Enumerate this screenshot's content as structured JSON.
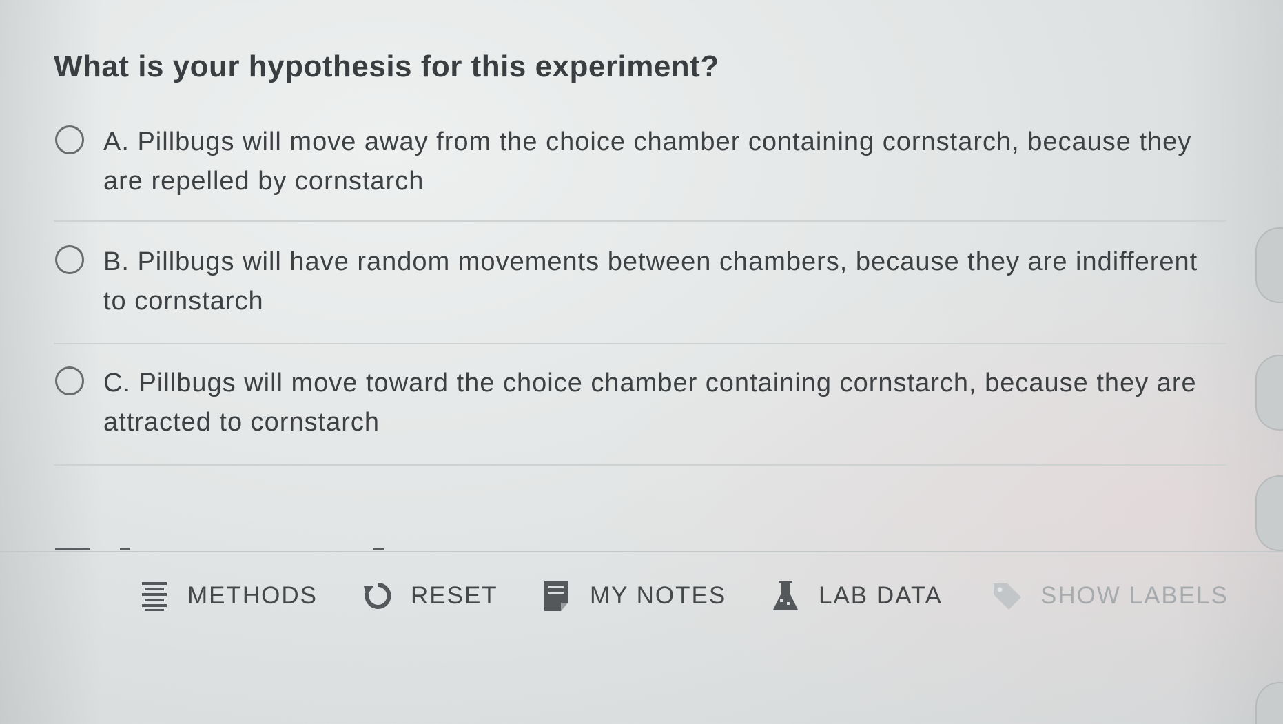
{
  "question": {
    "title": "What is your hypothesis for this experiment?",
    "options": [
      {
        "text": "A. Pillbugs will move away from the choice chamber containing cornstarch, because they are repelled by cornstarch",
        "selected": false
      },
      {
        "text": "B. Pillbugs will have random movements between chambers, because they are indifferent to cornstarch",
        "selected": false
      },
      {
        "text": "C. Pillbugs will move toward the choice chamber containing cornstarch, because they are attracted to cornstarch",
        "selected": false
      }
    ]
  },
  "toolbar": {
    "methods": {
      "label": "METHODS",
      "icon": "methods-list-icon"
    },
    "reset": {
      "label": "RESET",
      "icon": "reset-icon"
    },
    "my_notes": {
      "label": "MY NOTES",
      "icon": "notes-icon"
    },
    "lab_data": {
      "label": "LAB DATA",
      "icon": "flask-icon"
    },
    "show_labels": {
      "label": "SHOW LABELS",
      "icon": "tag-icon",
      "disabled": true
    }
  },
  "colors": {
    "background": "#e3e6e6",
    "text": "#3e4143",
    "divider": "#cfd2d3",
    "disabled_text": "#a7abad"
  }
}
